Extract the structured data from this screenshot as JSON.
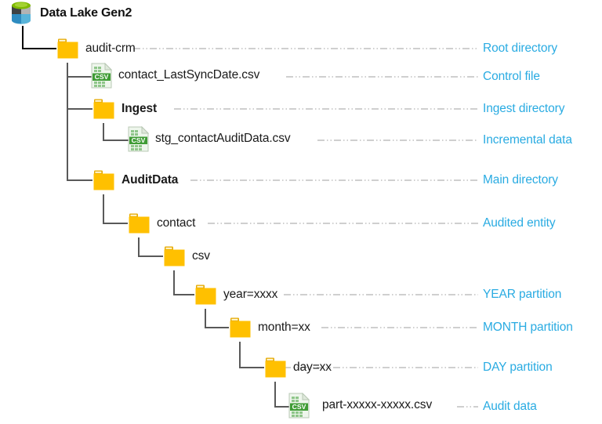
{
  "diagram": {
    "title": "Data Lake Gen2",
    "root_icon": "data-lake-icon",
    "accent_color": "#29abe2",
    "folder_color": "#ffc000",
    "csv_color": "#3f9c35",
    "leader_line_color": "#bfbfbf"
  },
  "tree": [
    {
      "id": "audit-crm",
      "label": "audit-crm",
      "icon": "folder-icon",
      "bold": false,
      "depth": 1,
      "annotation": "Root directory"
    },
    {
      "id": "contact-lastsyncdate-csv",
      "label": "contact_LastSyncDate.csv",
      "icon": "csv-file-icon",
      "bold": false,
      "depth": 2,
      "annotation": "Control file"
    },
    {
      "id": "ingest",
      "label": "Ingest",
      "icon": "folder-icon",
      "bold": true,
      "depth": 2,
      "annotation": "Ingest directory"
    },
    {
      "id": "stg-contactauditdata-csv",
      "label": "stg_contactAuditData.csv",
      "icon": "csv-file-icon",
      "bold": false,
      "depth": 3,
      "annotation": "Incremental data"
    },
    {
      "id": "auditdata",
      "label": "AuditData",
      "icon": "folder-icon",
      "bold": true,
      "depth": 2,
      "annotation": "Main directory"
    },
    {
      "id": "contact",
      "label": "contact",
      "icon": "folder-icon",
      "bold": false,
      "depth": 3,
      "annotation": "Audited entity"
    },
    {
      "id": "csv",
      "label": "csv",
      "icon": "folder-icon",
      "bold": false,
      "depth": 4,
      "annotation": ""
    },
    {
      "id": "year-partition",
      "label": "year=xxxx",
      "icon": "folder-icon",
      "bold": false,
      "depth": 5,
      "annotation": "YEAR partition"
    },
    {
      "id": "month-partition",
      "label": "month=xx",
      "icon": "folder-icon",
      "bold": false,
      "depth": 6,
      "annotation": "MONTH partition"
    },
    {
      "id": "day-partition",
      "label": "day=xx",
      "icon": "folder-icon",
      "bold": false,
      "depth": 7,
      "annotation": "DAY partition"
    },
    {
      "id": "part-file",
      "label": "part-xxxxx-xxxxx.csv",
      "icon": "csv-file-icon",
      "bold": false,
      "depth": 8,
      "annotation": "Audit data"
    }
  ],
  "annotations": {
    "root_directory": "Root directory",
    "control_file": "Control file",
    "ingest_directory": "Ingest directory",
    "incremental_data": "Incremental data",
    "main_directory": "Main directory",
    "audited_entity": "Audited entity",
    "year_partition": "YEAR partition",
    "month_partition": "MONTH partition",
    "day_partition": "DAY partition",
    "audit_data": "Audit data"
  }
}
